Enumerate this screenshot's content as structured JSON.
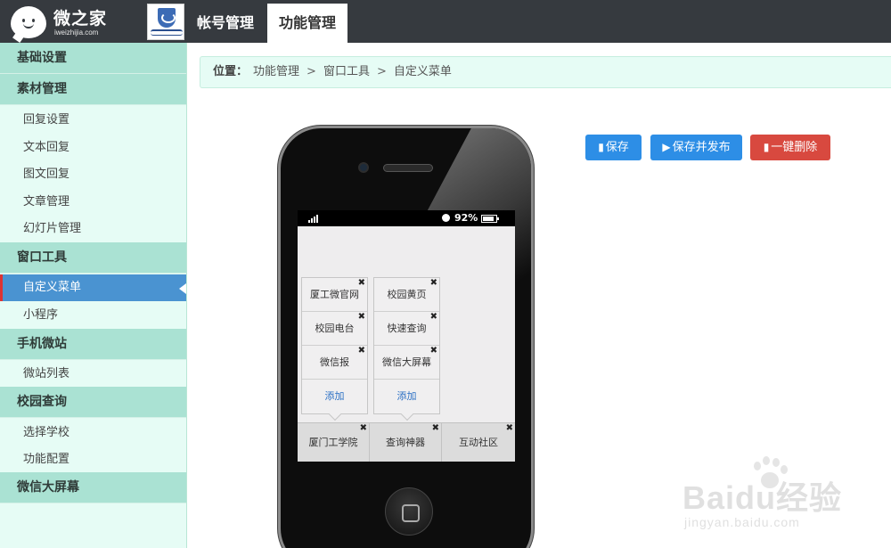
{
  "topbar": {
    "logo_title": "微之家",
    "logo_sub": "iweizhijia.com",
    "tabs": [
      {
        "label": "帐号管理",
        "active": false
      },
      {
        "label": "功能管理",
        "active": true
      }
    ]
  },
  "sidebar": {
    "sections": [
      {
        "title": "基础设置",
        "items": []
      },
      {
        "title": "素材管理",
        "items": [
          "回复设置",
          "文本回复",
          "图文回复",
          "文章管理",
          "幻灯片管理"
        ]
      },
      {
        "title": "窗口工具",
        "items": [
          "自定义菜单",
          "小程序"
        ]
      },
      {
        "title": "手机微站",
        "items": [
          "微站列表"
        ]
      },
      {
        "title": "校园查询",
        "items": [
          "选择学校",
          "功能配置"
        ]
      },
      {
        "title": "微信大屏幕",
        "items": []
      }
    ],
    "active_item": "自定义菜单",
    "colors": {
      "header": "#aae2d3",
      "background": "#e6fcf5",
      "active": "#4a93d1"
    }
  },
  "breadcrumb": {
    "label": "位置：",
    "path": [
      "功能管理",
      "窗口工具",
      "自定义菜单"
    ],
    "separator": ">"
  },
  "actions": {
    "save": "保存",
    "save_publish": "保存并发布",
    "delete_all": "一键删除",
    "colors": {
      "primary": "#2d8ee6",
      "danger": "#d8493f"
    }
  },
  "phone": {
    "status": {
      "battery": "92%"
    },
    "submenus": [
      {
        "items": [
          "厦工微官网",
          "校园黄页"
        ]
      },
      {
        "items": [
          "校园电台",
          "快速查询"
        ]
      },
      {
        "items": [
          "微信报",
          "微信大屏幕"
        ]
      }
    ],
    "submenu_columns": [
      [
        "厦工微官网",
        "校园电台",
        "微信报"
      ],
      [
        "校园黄页",
        "快速查询",
        "微信大屏幕"
      ]
    ],
    "add_label": "添加",
    "main_menu": [
      "厦门工学院",
      "查询神器",
      "互动社区"
    ]
  },
  "watermark": {
    "text": "Baidu经验",
    "url": "jingyan.baidu.com"
  }
}
